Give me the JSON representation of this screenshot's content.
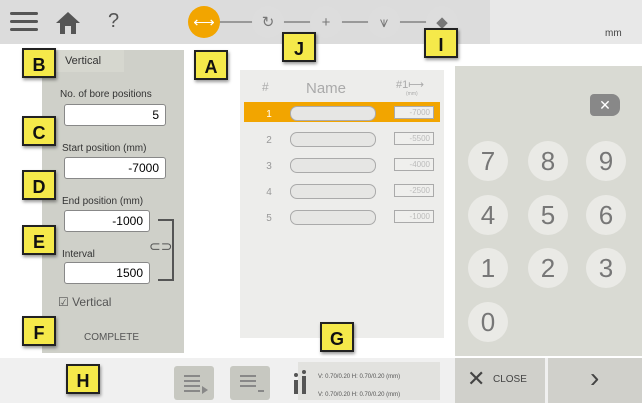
{
  "toolbar": {
    "help_label": "?",
    "unit_label": "mm"
  },
  "left_panel": {
    "tab_label": "Vertical",
    "bore_positions": {
      "label": "No. of bore positions",
      "value": "5"
    },
    "start_position": {
      "label": "Start position (mm)",
      "value": "-7000"
    },
    "end_position": {
      "label": "End position (mm)",
      "value": "-1000"
    },
    "interval": {
      "label": "Interval",
      "value": "1500"
    },
    "vertical_check_label": "Vertical",
    "complete_label": "COMPLETE"
  },
  "table": {
    "col_num": "#",
    "col_name": "Name",
    "col_pos": "#1⟼",
    "col_pos_sub": "(mm)",
    "rows": [
      {
        "num": "1",
        "value": "-7000"
      },
      {
        "num": "2",
        "value": "-5500"
      },
      {
        "num": "3",
        "value": "-4000"
      },
      {
        "num": "4",
        "value": "-2500"
      },
      {
        "num": "5",
        "value": "-1000"
      }
    ]
  },
  "keypad": {
    "keys": [
      "7",
      "8",
      "9",
      "4",
      "5",
      "6",
      "1",
      "2",
      "3",
      "0"
    ],
    "backspace": "✕"
  },
  "bottom": {
    "close_label": "CLOSE",
    "next_label": "›",
    "info_line1": "V: 0.70/0.20 H: 0.70/0.20 (mm)",
    "info_line2": "V: 0.70/0.20 H: 0.70/0.20 (mm)"
  },
  "callouts": [
    "A",
    "B",
    "C",
    "D",
    "E",
    "F",
    "G",
    "H",
    "I",
    "J"
  ]
}
